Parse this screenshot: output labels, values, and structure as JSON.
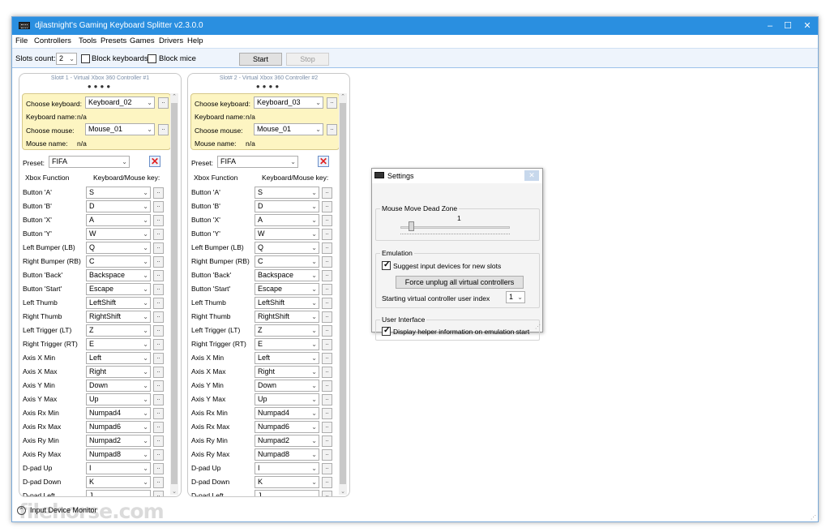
{
  "window": {
    "title": "djlastnight's Gaming Keyboard Splitter v2.3.0.0",
    "minimize": "–",
    "maximize": "☐",
    "close": "✕"
  },
  "menu": [
    "File",
    "Controllers",
    "Tools",
    "Presets",
    "Games",
    "Drivers",
    "Help"
  ],
  "toolbar": {
    "slots_label": "Slots count:",
    "slots_value": "2",
    "block_keyboards": "Block keyboards",
    "block_mice": "Block mice",
    "start": "Start",
    "stop": "Stop"
  },
  "slots": [
    {
      "title": "Slot# 1 - Virtual Xbox 360 Controller #1",
      "dots": "●●●●",
      "choose_keyboard_label": "Choose keyboard:",
      "keyboard": "Keyboard_02",
      "keyboard_name_label": "Keyboard name:",
      "keyboard_name": "n/a",
      "choose_mouse_label": "Choose mouse:",
      "mouse": "Mouse_01",
      "mouse_name_label": "Mouse name:",
      "mouse_name": "n/a",
      "preset_label": "Preset:",
      "preset": "FIFA",
      "mappings": [
        "S",
        "D",
        "A",
        "W",
        "Q",
        "C",
        "Backspace",
        "Escape",
        "LeftShift",
        "RightShift",
        "Z",
        "E",
        "Left",
        "Right",
        "Down",
        "Up",
        "Numpad4",
        "Numpad6",
        "Numpad2",
        "Numpad8",
        "I",
        "K",
        "J"
      ]
    },
    {
      "title": "Slot# 2 - Virtual Xbox 360 Controller #2",
      "dots": "●●●●",
      "choose_keyboard_label": "Choose keyboard:",
      "keyboard": "Keyboard_03",
      "keyboard_name_label": "Keyboard name:",
      "keyboard_name": "n/a",
      "choose_mouse_label": "Choose mouse:",
      "mouse": "Mouse_01",
      "mouse_name_label": "Mouse name:",
      "mouse_name": "n/a",
      "preset_label": "Preset:",
      "preset": "FIFA",
      "mappings": [
        "S",
        "D",
        "A",
        "W",
        "Q",
        "C",
        "Backspace",
        "Escape",
        "LeftShift",
        "RightShift",
        "Z",
        "E",
        "Left",
        "Right",
        "Down",
        "Up",
        "Numpad4",
        "Numpad6",
        "Numpad2",
        "Numpad8",
        "I",
        "K",
        "J"
      ]
    }
  ],
  "mapping_header": {
    "function": "Xbox Function",
    "key": "Keyboard/Mouse key:"
  },
  "functions": [
    "Button 'A'",
    "Button 'B'",
    "Button 'X'",
    "Button 'Y'",
    "Left Bumper (LB)",
    "Right Bumper (RB)",
    "Button 'Back'",
    "Button 'Start'",
    "Left Thumb",
    "Right Thumb",
    "Left Trigger (LT)",
    "Right Trigger (RT)",
    "Axis X Min",
    "Axis X Max",
    "Axis Y Min",
    "Axis Y Max",
    "Axis Rx Min",
    "Axis Rx Max",
    "Axis Ry Min",
    "Axis Ry Max",
    "D-pad Up",
    "D-pad Down",
    "D-pad Left"
  ],
  "status": {
    "monitor_label": "Input Device Monitor",
    "watermark": "filehorse.com"
  },
  "settings": {
    "title": "Settings",
    "close": "✕",
    "deadzone_title": "Mouse Move Dead Zone",
    "deadzone_value": "1",
    "emulation_title": "Emulation",
    "suggest_devices": "Suggest input devices for new slots",
    "force_unplug": "Force unplug all virtual controllers",
    "start_index_label": "Starting virtual controller user index",
    "start_index_value": "1",
    "ui_title": "User Interface",
    "helper_info": "Display helper information on emulation start"
  }
}
